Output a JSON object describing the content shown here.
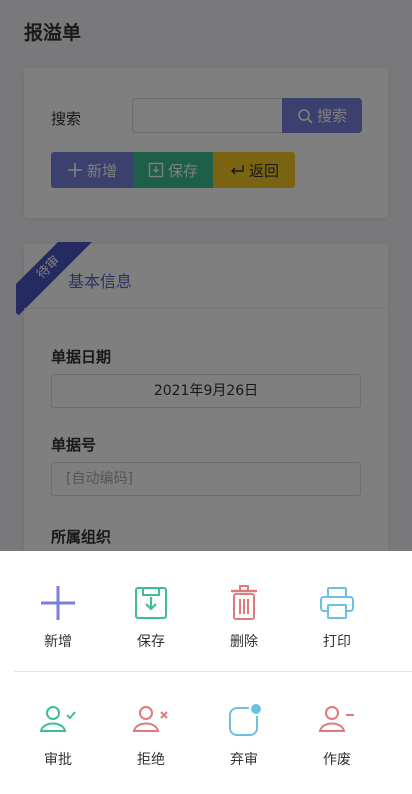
{
  "page": {
    "title": "报溢单"
  },
  "search": {
    "label": "搜索",
    "button_label": "搜索"
  },
  "toolbar": {
    "add_label": "新增",
    "save_label": "保存",
    "back_label": "返回"
  },
  "info": {
    "ribbon": "待审",
    "title": "基本信息",
    "date_label": "单据日期",
    "date_value": "2021年9月26日",
    "code_label": "单据号",
    "code_placeholder": "[自动编码]",
    "org_label": "所属组织"
  },
  "sheet": {
    "row1": [
      {
        "label": "新增",
        "icon": "plus-icon"
      },
      {
        "label": "保存",
        "icon": "save-icon"
      },
      {
        "label": "删除",
        "icon": "trash-icon"
      },
      {
        "label": "打印",
        "icon": "printer-icon"
      }
    ],
    "row2": [
      {
        "label": "审批",
        "icon": "user-check-icon"
      },
      {
        "label": "拒绝",
        "icon": "user-x-icon"
      },
      {
        "label": "弃审",
        "icon": "abandon-review-icon"
      },
      {
        "label": "作废",
        "icon": "user-minus-icon"
      }
    ]
  },
  "colors": {
    "primary": "#7880dc",
    "success": "#3dbf95",
    "warning": "#f5c623",
    "danger": "#e07a7a",
    "info": "#6cc0e0"
  }
}
